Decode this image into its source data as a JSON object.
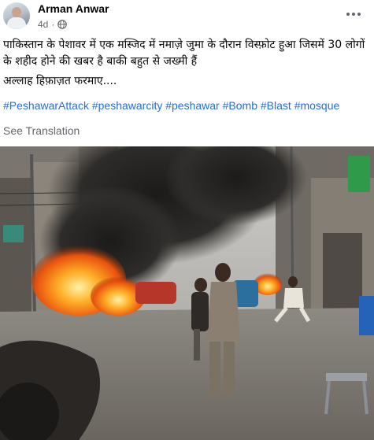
{
  "post": {
    "author": "Arman Anwar",
    "timestamp": "4d",
    "privacy_icon": "globe-icon",
    "more_icon": "more-options-icon",
    "text_line1": "पाकिस्तान के पेशावर में एक मस्जिद में नमाज़े जुमा के दौरान विस्फ़ोट हुआ जिसमें 30 लोगों के शहीद होने की खबर है बाकी बहुत से जख्मी हैं",
    "text_line2": "अल्लाह हिफ़ाज़त फरमाए....",
    "hashtags": [
      "#PeshawarAttack",
      "#peshawarcity",
      "#peshawar",
      "#Bomb",
      "#Blast",
      "#mosque"
    ],
    "see_translation": "See Translation",
    "photo_subject": "bomb-blast-street-scene-photo"
  },
  "colors": {
    "link": "#216fdb",
    "secondary_text": "#65676b",
    "primary_text": "#050505"
  }
}
